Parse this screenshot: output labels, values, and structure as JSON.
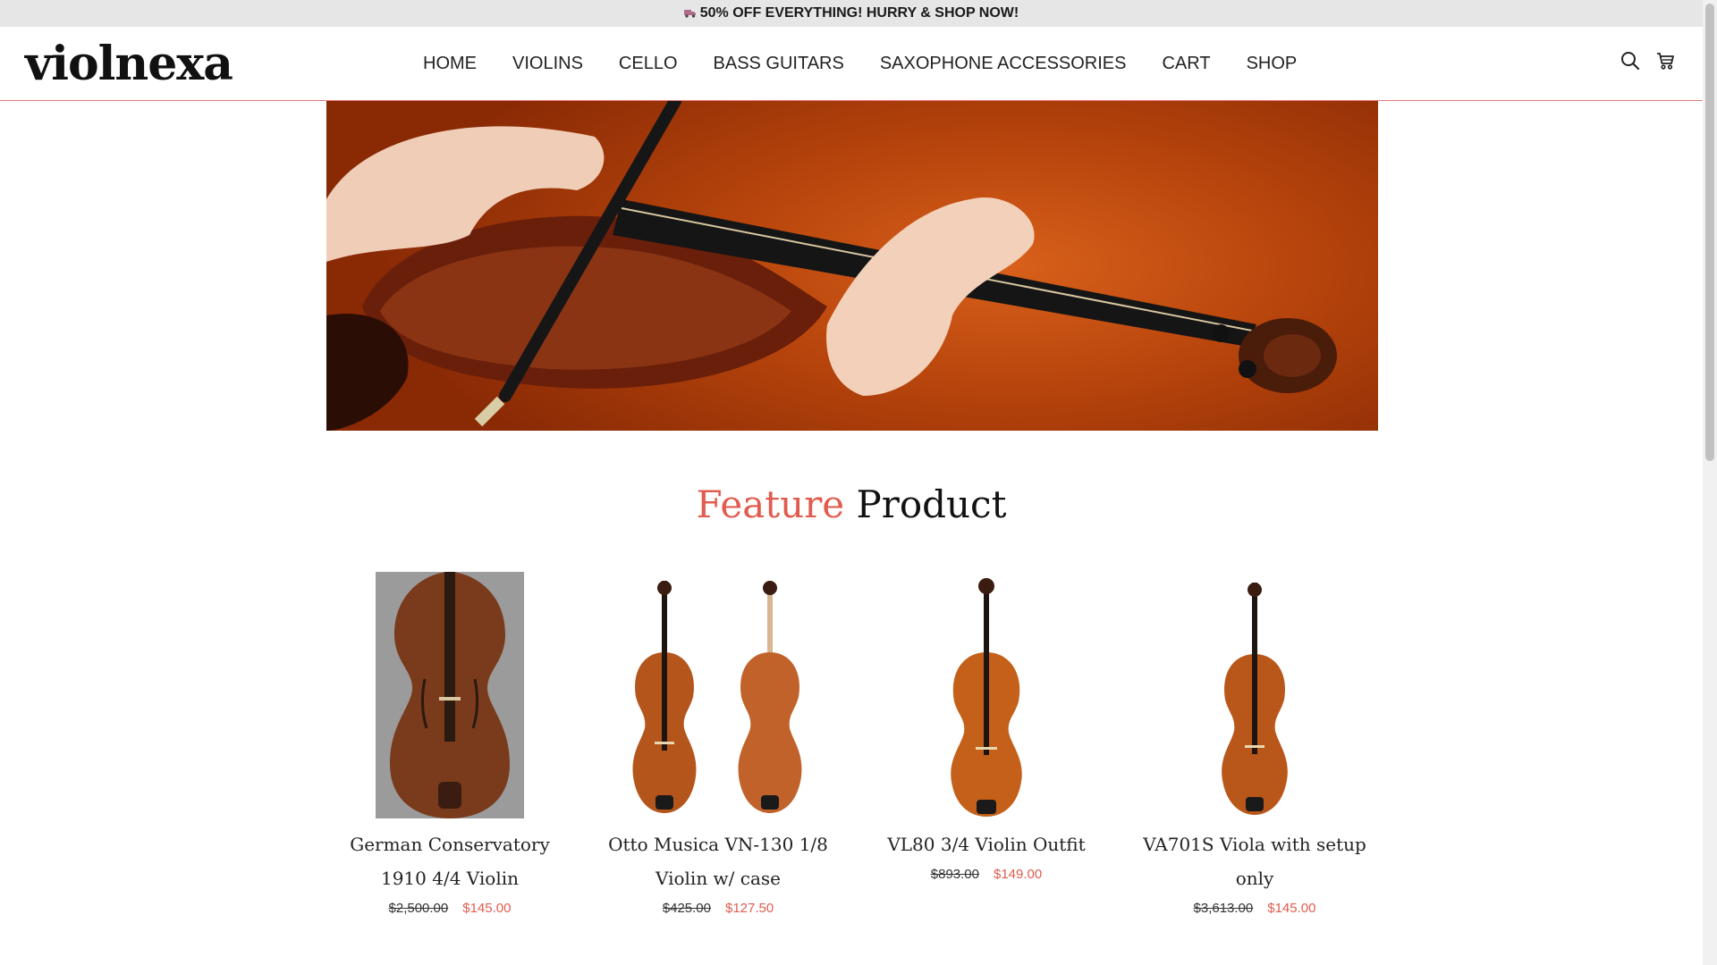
{
  "announcement": {
    "icon": "truck-icon",
    "text": "50% OFF EVERYTHING! HURRY & SHOP NOW!"
  },
  "header": {
    "logo": "violnexa",
    "nav": [
      "HOME",
      "VIOLINS",
      "CELLO",
      "BASS GUITARS",
      "SAXOPHONE ACCESSORIES",
      "CART",
      "SHOP"
    ],
    "icons": [
      "search-icon",
      "cart-icon"
    ]
  },
  "hero": {
    "image": "violin-player-hero-image"
  },
  "featured": {
    "title_accent": "Feature",
    "title_rest": " Product",
    "products": [
      {
        "name": "German Conservatory 1910 4/4 Violin",
        "old_price": "$2,500.00",
        "price": "$145.00"
      },
      {
        "name": "Otto Musica VN-130 1/8 Violin w/ case",
        "old_price": "$425.00",
        "price": "$127.50"
      },
      {
        "name": "VL80 3/4 Violin Outfit",
        "old_price": "$893.00",
        "price": "$149.00"
      },
      {
        "name": "VA701S Viola with setup only",
        "old_price": "$3,613.00",
        "price": "$145.00"
      }
    ]
  },
  "colors": {
    "accent": "#e15c4f",
    "announcement_bg": "#e6e6e6",
    "header_border": "#e27b7b",
    "hero_orange": "#c9510f"
  }
}
